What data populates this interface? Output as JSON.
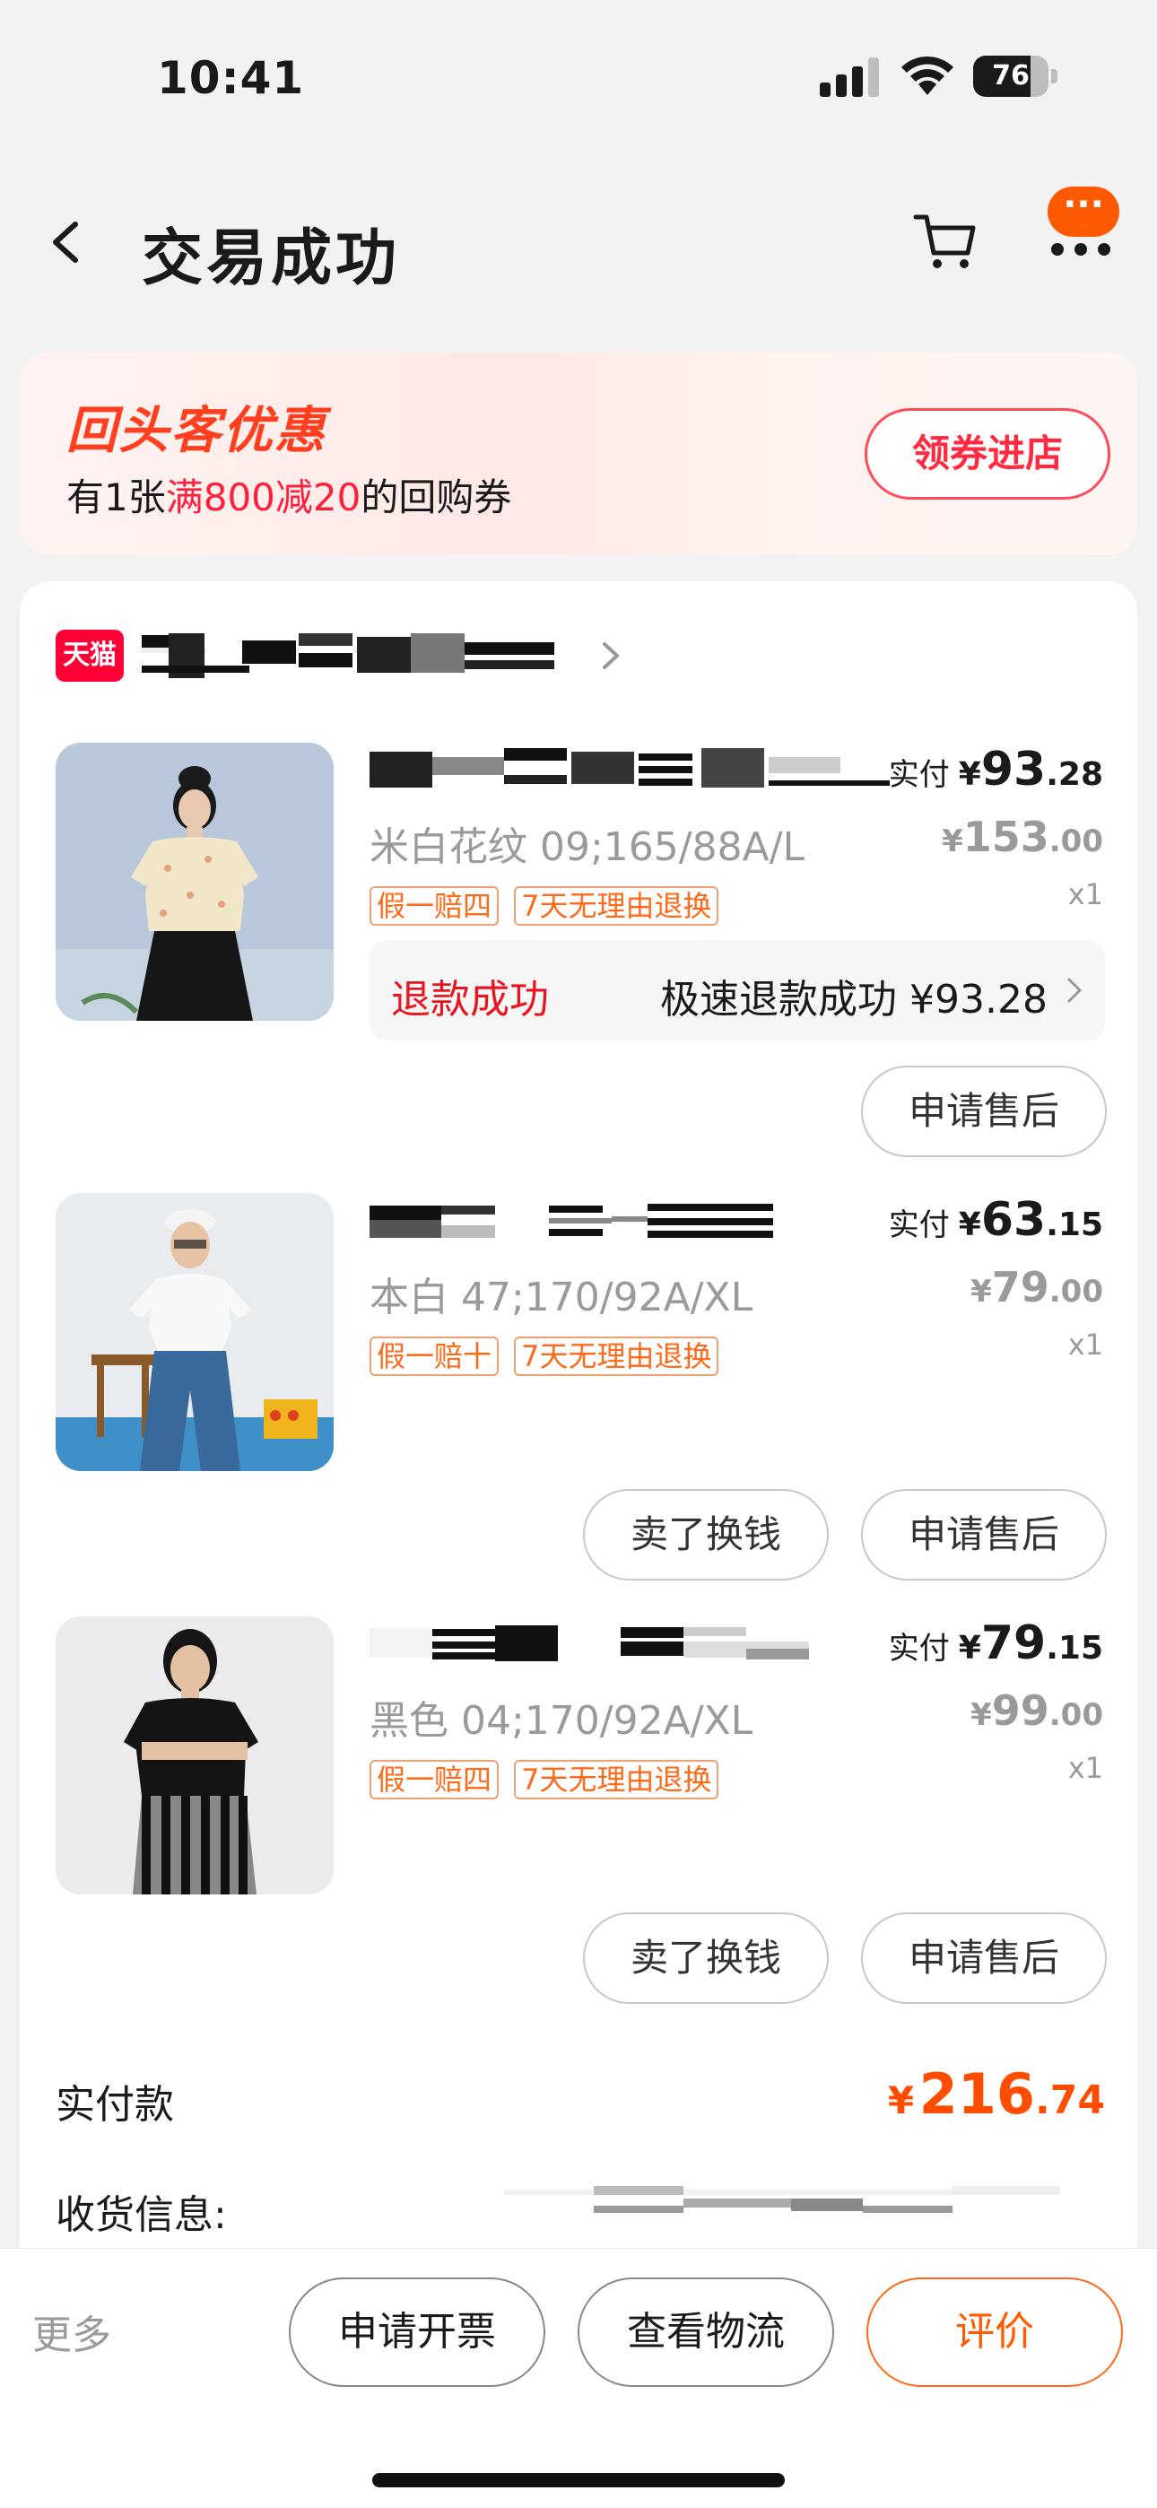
{
  "status_bar": {
    "time": "10:41",
    "battery": "76",
    "battery_level": 0.76
  },
  "header": {
    "title": "交易成功",
    "more_badge": "···"
  },
  "promo": {
    "title": "回头客优惠",
    "desc_prefix": "有1张",
    "desc_highlight": "满800减20",
    "desc_suffix": "的回购券",
    "button": "领券进店"
  },
  "shop": {
    "badge": "天猫"
  },
  "items": [
    {
      "sku": "米白花纹 09;165/88A/L",
      "tags": [
        "假一赔四",
        "7天无理由退换"
      ],
      "paid_label": "实付",
      "paid_yen": "¥",
      "paid_int": "93",
      "paid_dec": ".28",
      "orig_yen": "¥",
      "orig_int": "153",
      "orig_dec": ".00",
      "qty": "x1",
      "refund_status": "退款成功",
      "refund_detail": "极速退款成功 ¥93.28",
      "buttons": [
        "申请售后"
      ]
    },
    {
      "sku": "本白 47;170/92A/XL",
      "tags": [
        "假一赔十",
        "7天无理由退换"
      ],
      "paid_label": "实付",
      "paid_yen": "¥",
      "paid_int": "63",
      "paid_dec": ".15",
      "orig_yen": "¥",
      "orig_int": "79",
      "orig_dec": ".00",
      "qty": "x1",
      "buttons": [
        "卖了换钱",
        "申请售后"
      ]
    },
    {
      "sku": "黑色 04;170/92A/XL",
      "tags": [
        "假一赔四",
        "7天无理由退换"
      ],
      "paid_label": "实付",
      "paid_yen": "¥",
      "paid_int": "79",
      "paid_dec": ".15",
      "orig_yen": "¥",
      "orig_int": "99",
      "orig_dec": ".00",
      "qty": "x1",
      "buttons": [
        "卖了换钱",
        "申请售后"
      ]
    }
  ],
  "total": {
    "label": "实付款",
    "yen": "¥",
    "int": "216",
    "dec": ".74"
  },
  "shipping": {
    "label": "收货信息:"
  },
  "bottom_bar": {
    "more": "更多",
    "invoice": "申请开票",
    "logistics": "查看物流",
    "review": "评价"
  },
  "colors": {
    "accent": "#ff5a00",
    "price_total": "#ff4d00",
    "refund_red": "#e8141e",
    "promo_red": "#ff3f1f",
    "tmall_red": "#ff0036"
  }
}
